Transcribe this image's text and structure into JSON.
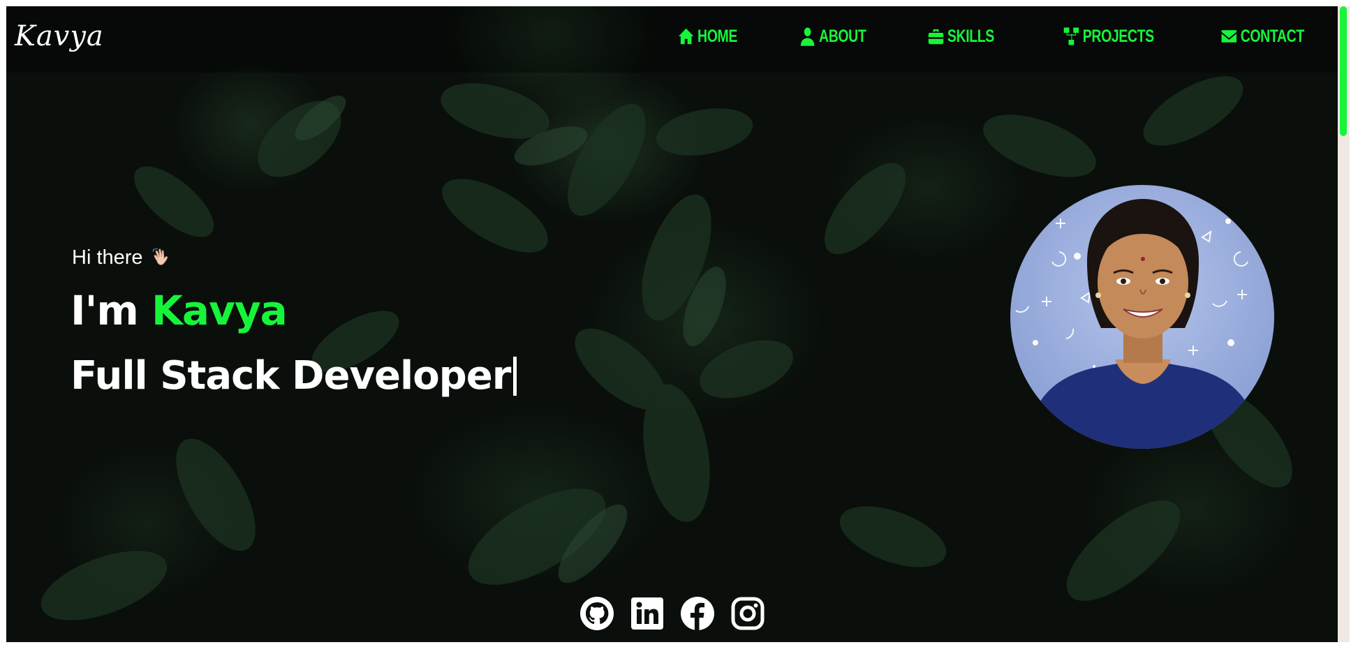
{
  "brand": {
    "logo": "Kavya"
  },
  "nav": {
    "items": [
      {
        "label": "HOME",
        "icon": "home-icon"
      },
      {
        "label": "ABOUT",
        "icon": "user-icon"
      },
      {
        "label": "SKILLS",
        "icon": "toolbox-icon"
      },
      {
        "label": "PROJECTS",
        "icon": "sitemap-icon"
      },
      {
        "label": "CONTACT",
        "icon": "envelope-icon"
      }
    ]
  },
  "hero": {
    "greeting": "Hi there",
    "greeting_icon": "waving-hand-icon",
    "intro_prefix": "I'm",
    "name": "Kavya",
    "role": "Full Stack Developer"
  },
  "profile": {
    "avatar_icon": "profile-photo"
  },
  "socials": [
    {
      "icon": "github-icon"
    },
    {
      "icon": "linkedin-icon"
    },
    {
      "icon": "facebook-icon"
    },
    {
      "icon": "instagram-icon"
    }
  ],
  "colors": {
    "accent": "#17f53a",
    "background": "#0a0f0b",
    "text": "#ffffff"
  }
}
